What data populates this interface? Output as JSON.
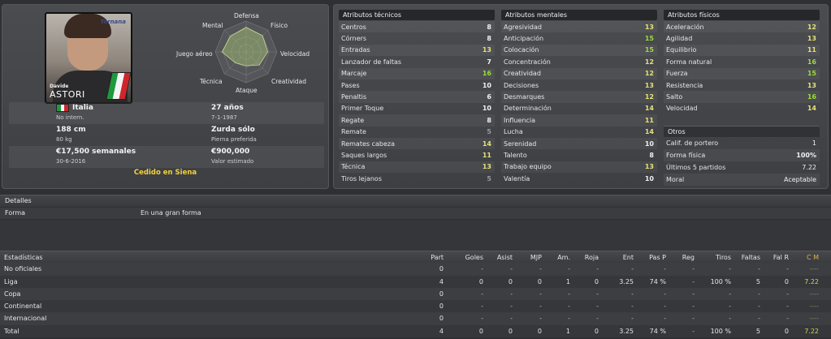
{
  "player": {
    "first_name": "Davide",
    "last_name": "ASTORI",
    "club_logo_text": "Ternana",
    "nationality": "Italia",
    "intl_status": "No intern.",
    "age": "27 años",
    "birth_date": "7-1-1987",
    "height": "188 cm",
    "weight": "80 kg",
    "foot": "Zurda sólo",
    "foot_label": "Pierna preferida",
    "wage": "€17,500 semanales",
    "contract_end": "30-6-2016",
    "value": "€900,000",
    "value_label": "Valor estimado",
    "loan_status": "Cedido en Siena"
  },
  "radar": {
    "labels": {
      "defensa": "Defensa",
      "fisico": "Físico",
      "velocidad": "Velocidad",
      "creatividad": "Creatividad",
      "ataque": "Ataque",
      "tecnica": "Técnica",
      "juego_aereo": "Juego aéreo",
      "mental": "Mental"
    },
    "levels": [
      0.8,
      0.75,
      0.7,
      0.6,
      0.45,
      0.5,
      0.78,
      0.72
    ]
  },
  "colors": {
    "high": "#9cdc3c",
    "mid": "#e6e07a",
    "normal": "#f0f0f0",
    "low": "#9a9a9a",
    "loan": "#f2d23a",
    "italy_green": "#1e9a3c",
    "italy_white": "#f4f4f4",
    "italy_red": "#d0262b"
  },
  "technical": {
    "title": "Atributos técnicos",
    "items": [
      {
        "label": "Centros",
        "value": "8"
      },
      {
        "label": "Córners",
        "value": "8"
      },
      {
        "label": "Entradas",
        "value": "13"
      },
      {
        "label": "Lanzador de faltas",
        "value": "7"
      },
      {
        "label": "Marcaje",
        "value": "16"
      },
      {
        "label": "Pases",
        "value": "10"
      },
      {
        "label": "Penaltis",
        "value": "6"
      },
      {
        "label": "Primer Toque",
        "value": "10"
      },
      {
        "label": "Regate",
        "value": "8"
      },
      {
        "label": "Remate",
        "value": "5"
      },
      {
        "label": "Remates cabeza",
        "value": "14"
      },
      {
        "label": "Saques largos",
        "value": "11"
      },
      {
        "label": "Técnica",
        "value": "13"
      },
      {
        "label": "Tiros lejanos",
        "value": "5"
      }
    ]
  },
  "mental": {
    "title": "Atributos mentales",
    "items": [
      {
        "label": "Agresividad",
        "value": "13"
      },
      {
        "label": "Anticipación",
        "value": "15"
      },
      {
        "label": "Colocación",
        "value": "15"
      },
      {
        "label": "Concentración",
        "value": "12"
      },
      {
        "label": "Creatividad",
        "value": "12"
      },
      {
        "label": "Decisiones",
        "value": "13"
      },
      {
        "label": "Desmarques",
        "value": "12"
      },
      {
        "label": "Determinación",
        "value": "14"
      },
      {
        "label": "Influencia",
        "value": "11"
      },
      {
        "label": "Lucha",
        "value": "14"
      },
      {
        "label": "Serenidad",
        "value": "10"
      },
      {
        "label": "Talento",
        "value": "8"
      },
      {
        "label": "Trabajo equipo",
        "value": "13"
      },
      {
        "label": "Valentía",
        "value": "10"
      }
    ]
  },
  "physical": {
    "title": "Atributos físicos",
    "items": [
      {
        "label": "Aceleración",
        "value": "12"
      },
      {
        "label": "Agilidad",
        "value": "13"
      },
      {
        "label": "Equilibrio",
        "value": "11"
      },
      {
        "label": "Forma natural",
        "value": "16"
      },
      {
        "label": "Fuerza",
        "value": "15"
      },
      {
        "label": "Resistencia",
        "value": "13"
      },
      {
        "label": "Salto",
        "value": "16"
      },
      {
        "label": "Velocidad",
        "value": "14"
      }
    ]
  },
  "otros": {
    "title": "Otros",
    "items": [
      {
        "label": "Calif. de portero",
        "value": "1"
      },
      {
        "label": "Forma física",
        "value": "100%"
      },
      {
        "label": "Últimos 5 partidos",
        "value": "7.22"
      },
      {
        "label": "Moral",
        "value": "Aceptable"
      }
    ]
  },
  "details": {
    "title": "Detalles",
    "row_label": "Forma",
    "row_value": "En una gran forma"
  },
  "stats": {
    "title": "Estadísticas",
    "columns": [
      "Part",
      "Goles",
      "Asist",
      "MJP",
      "Am.",
      "Roja",
      "Ent",
      "Pas P",
      "Reg",
      "Tiros",
      "Faltas",
      "Fal R",
      "C M"
    ],
    "rows": [
      {
        "name": "No oficiales",
        "values": [
          "0",
          "-",
          "-",
          "-",
          "-",
          "-",
          "-",
          "-",
          "-",
          "-",
          "-",
          "-",
          "----"
        ]
      },
      {
        "name": "Liga",
        "values": [
          "4",
          "0",
          "0",
          "0",
          "1",
          "0",
          "3.25",
          "74 %",
          "-",
          "100 %",
          "5",
          "0",
          "7.22"
        ]
      },
      {
        "name": "Copa",
        "values": [
          "0",
          "-",
          "-",
          "-",
          "-",
          "-",
          "-",
          "-",
          "-",
          "-",
          "-",
          "-",
          "----"
        ]
      },
      {
        "name": "Continental",
        "values": [
          "0",
          "-",
          "-",
          "-",
          "-",
          "-",
          "-",
          "-",
          "-",
          "-",
          "-",
          "-",
          "----"
        ]
      },
      {
        "name": "Internacional",
        "values": [
          "0",
          "-",
          "-",
          "-",
          "-",
          "-",
          "-",
          "-",
          "-",
          "-",
          "-",
          "-",
          "----"
        ]
      },
      {
        "name": "Total",
        "values": [
          "4",
          "0",
          "0",
          "0",
          "1",
          "0",
          "3.25",
          "74 %",
          "-",
          "100 %",
          "5",
          "0",
          "7.22"
        ]
      }
    ]
  }
}
